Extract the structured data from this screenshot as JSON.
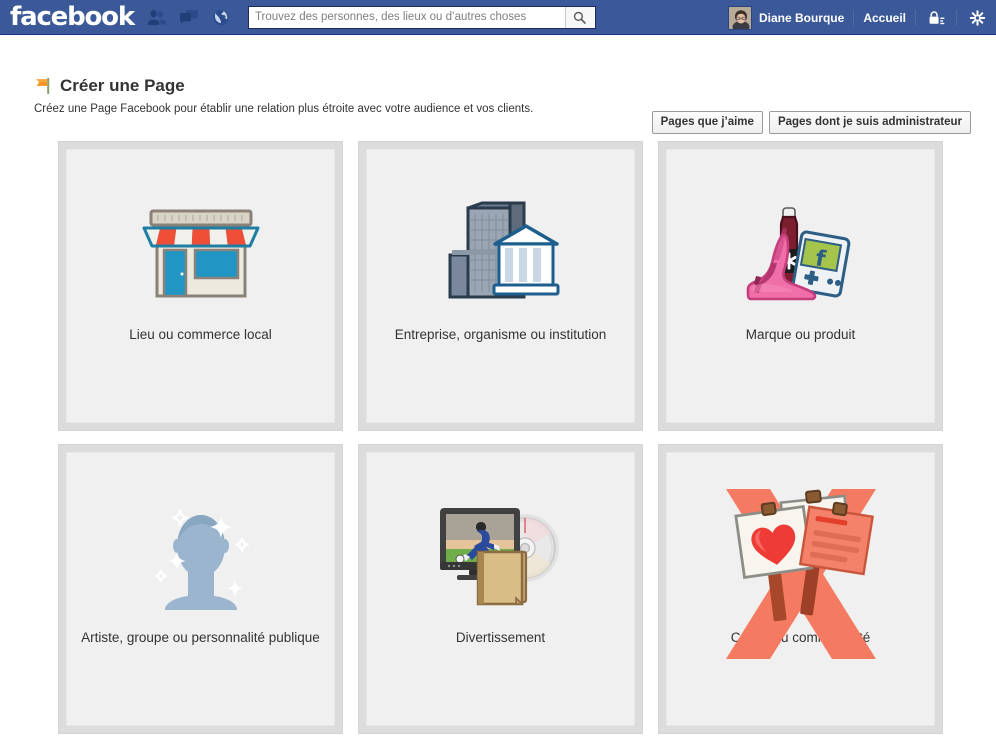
{
  "topbar": {
    "logo": "facebook",
    "icons": [
      {
        "name": "friend-requests-icon",
        "label": "friends"
      },
      {
        "name": "messages-icon",
        "label": "messages"
      },
      {
        "name": "notifications-icon",
        "label": "notifications"
      }
    ],
    "search": {
      "placeholder": "Trouvez des personnes, des lieux ou d’autres choses",
      "value": "",
      "button_icon": "search-icon"
    },
    "account": {
      "avatar_name": "avatar",
      "user_name": "Diane Bourque",
      "home_link": "Accueil",
      "privacy_icon": "privacy-lock-icon",
      "settings_icon": "gear-icon"
    },
    "colors": {
      "bar": "#3b5998",
      "bar_border": "#133783",
      "text": "#ffffff"
    }
  },
  "header": {
    "icon": "orange-flag-icon",
    "title": "Créer une Page",
    "subtitle": "Créez une Page Facebook pour établir une relation plus étroite avec votre audience et vos clients.",
    "buttons": [
      {
        "name": "pages-i-like-button",
        "label": "Pages que j’aime"
      },
      {
        "name": "pages-i-admin-button",
        "label": "Pages dont je suis administrateur"
      }
    ]
  },
  "categories": [
    {
      "id": "local-business",
      "label": "Lieu ou commerce local",
      "icon": "storefront-icon",
      "colors": {
        "awning_red": "#ef4f36",
        "awning_white": "#f1f0ea",
        "window": "#2196c4",
        "frame": "#8a8278"
      }
    },
    {
      "id": "company-organization",
      "label": "Entreprise, organisme ou institution",
      "icon": "office-and-institution-icon",
      "colors": {
        "tower": "#8d99a6",
        "tower_dark": "#5d6b7a",
        "institution": "#ffffff",
        "outline": "#1c5e8e"
      }
    },
    {
      "id": "brand-product",
      "label": "Marque ou produit",
      "icon": "shoe-bottle-console-icon",
      "colors": {
        "shoe_pink": "#f06fa8",
        "bottle": "#7c1d30",
        "console_screen": "#a4c44c",
        "console_body": "#eef2f5"
      }
    },
    {
      "id": "artist-band-public-figure",
      "label": "Artiste, groupe ou personnalité publique",
      "icon": "sparkling-silhouette-icon",
      "colors": {
        "silhouette": "#9ab5cd",
        "sparkle": "#ffffff"
      }
    },
    {
      "id": "entertainment",
      "label": "Divertissement",
      "icon": "tv-disc-book-icon",
      "colors": {
        "tv_body": "#414141",
        "field": "#6fae4b",
        "player": "#2a4a9c",
        "book": "#d9bd86",
        "disc": "#e9e9e9"
      }
    },
    {
      "id": "cause-community",
      "label": "Cause ou communauté",
      "icon": "awareness-ribbon-signs-icon",
      "overlapping_art": true,
      "colors": {
        "ribbon": "#f47a62",
        "heart": "#ef3b35",
        "sign": "#f4f2ea",
        "stick": "#a8482a"
      }
    }
  ]
}
